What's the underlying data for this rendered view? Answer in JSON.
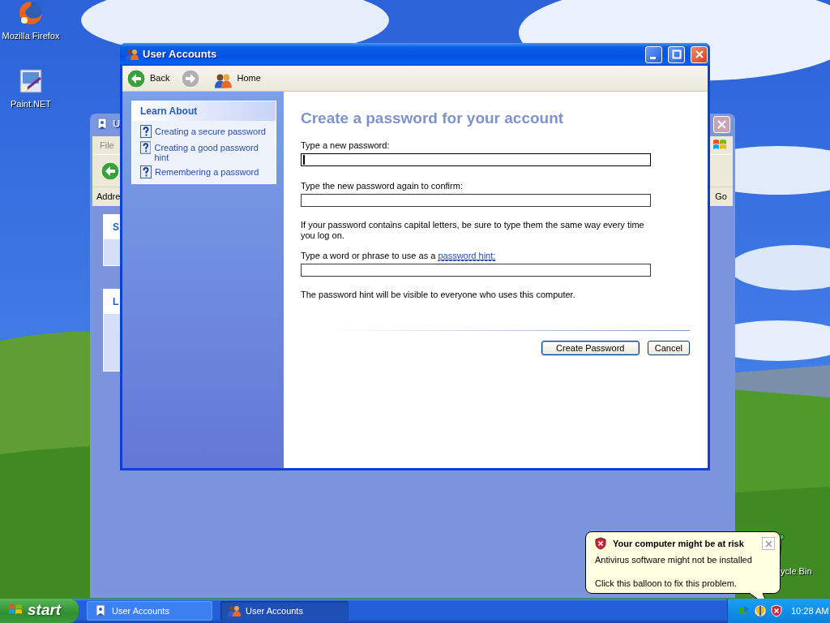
{
  "desktop_icons": [
    {
      "kind": "firefox",
      "label": "Mozilla Firefox"
    },
    {
      "kind": "paint",
      "label": "Paint.NET"
    },
    {
      "kind": "recycle",
      "label": "ycle Bin"
    }
  ],
  "background_window": {
    "title": "U",
    "menu": [
      "File"
    ],
    "address_label": "Addre",
    "go": "Go",
    "panels": [
      {
        "title": "S"
      },
      {
        "title": "L"
      }
    ]
  },
  "window": {
    "title": "User Accounts",
    "toolbar": [
      {
        "kind": "back",
        "label": "Back",
        "disabled": false
      },
      {
        "kind": "forward",
        "disabled": true
      },
      {
        "kind": "home",
        "label": "Home",
        "disabled": false
      }
    ],
    "sidebar": {
      "title": "Learn About",
      "links": [
        "Creating a secure password",
        "Creating a good password hint",
        "Remembering a password"
      ]
    },
    "heading": "Create a password for your account",
    "fields": [
      {
        "label": "Type a new password:",
        "focused": true
      },
      {
        "label": "Type the new password again to confirm:",
        "focused": false,
        "note": "If your password contains capital letters, be sure to type them the same way every time you log on."
      },
      {
        "label": "Type a word or phrase to use as a",
        "link": "password hint:",
        "focused": false,
        "note": "The password hint will be visible to everyone who uses this computer."
      }
    ],
    "buttons": [
      {
        "label": "Create Password",
        "default": true
      },
      {
        "label": "Cancel",
        "default": false
      }
    ]
  },
  "balloon": {
    "title": "Your computer might be at risk",
    "lines": [
      "Antivirus software might not be installed",
      "Click this balloon to fix this problem."
    ]
  },
  "taskbar": {
    "start": "start",
    "tasks": [
      {
        "kind": "wizard",
        "label": "User Accounts",
        "selected": false
      },
      {
        "kind": "users",
        "label": "User Accounts",
        "selected": true
      }
    ],
    "clock": "10:28 AM"
  }
}
